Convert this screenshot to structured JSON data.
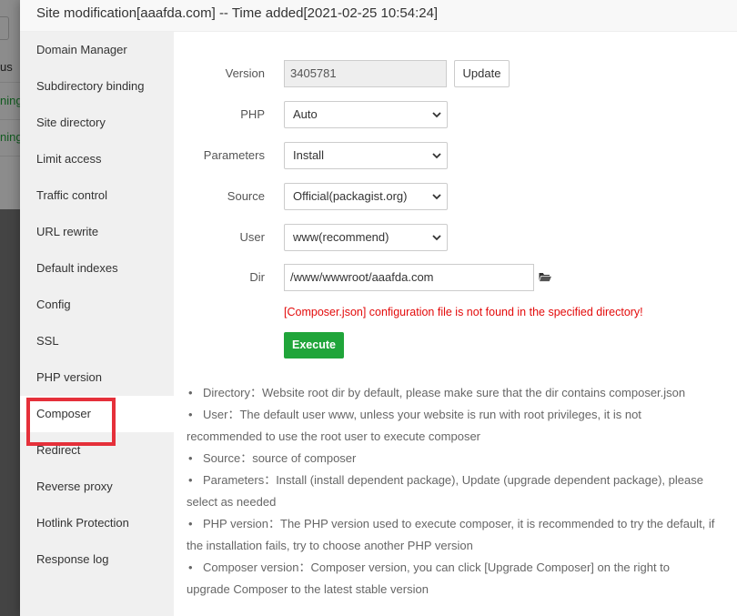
{
  "background": {
    "status_fragment": "us",
    "running_fragment_1": "ning",
    "running_fragment_2": "ning"
  },
  "modal": {
    "title": "Site modification[aaafda.com] -- Time added[2021-02-25 10:54:24]"
  },
  "sidebar": {
    "items": [
      {
        "label": "Domain Manager"
      },
      {
        "label": "Subdirectory binding"
      },
      {
        "label": "Site directory"
      },
      {
        "label": "Limit access"
      },
      {
        "label": "Traffic control"
      },
      {
        "label": "URL rewrite"
      },
      {
        "label": "Default indexes"
      },
      {
        "label": "Config"
      },
      {
        "label": "SSL"
      },
      {
        "label": "PHP version"
      },
      {
        "label": "Composer"
      },
      {
        "label": "Redirect"
      },
      {
        "label": "Reverse proxy"
      },
      {
        "label": "Hotlink Protection"
      },
      {
        "label": "Response log"
      }
    ],
    "active_index": 10
  },
  "form": {
    "version": {
      "label": "Version",
      "value": "3405781",
      "button": "Update"
    },
    "php": {
      "label": "PHP",
      "value": "Auto"
    },
    "parameters": {
      "label": "Parameters",
      "value": "Install"
    },
    "source": {
      "label": "Source",
      "value": "Official(packagist.org)"
    },
    "user": {
      "label": "User",
      "value": "www(recommend)"
    },
    "dir": {
      "label": "Dir",
      "value": "/www/wwwroot/aaafda.com"
    },
    "error": "[Composer.json] configuration file is not found in the specified directory!",
    "execute": "Execute"
  },
  "help": {
    "bullet": "•",
    "lines": [
      "Directory：Website root dir by default, please make sure that the dir contains composer.json",
      "User：The default user www, unless your website is run with root privileges, it is not",
      "recommended to use the root user to execute composer",
      "Source：source of composer",
      "Parameters：Install (install dependent package), Update (upgrade dependent package), please",
      "select as needed",
      "PHP version：The PHP version used to execute composer, it is recommended to try the default, if",
      "the installation fails, try to choose another PHP version",
      "Composer version：Composer version, you can click [Upgrade Composer] on the right to",
      "upgrade Composer to the latest stable version"
    ]
  },
  "colors": {
    "accent_green": "#20a53a",
    "error_red": "#e30b0b",
    "highlight_red": "#e5303a"
  }
}
